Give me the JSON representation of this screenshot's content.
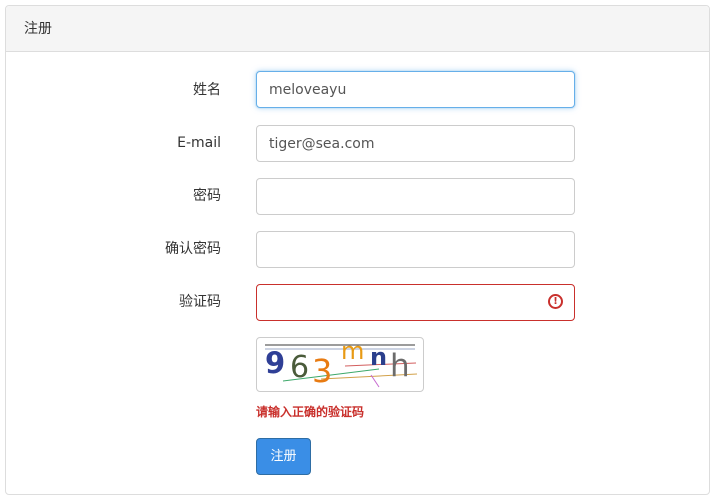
{
  "panel": {
    "title": "注册"
  },
  "form": {
    "fields": [
      {
        "label": "姓名",
        "value": "meloveayu",
        "placeholder": "",
        "state": "focused"
      },
      {
        "label": "E-mail",
        "value": "tiger@sea.com",
        "placeholder": "",
        "state": "normal"
      },
      {
        "label": "密码",
        "value": "",
        "placeholder": "",
        "state": "normal"
      },
      {
        "label": "确认密码",
        "value": "",
        "placeholder": "",
        "state": "normal"
      },
      {
        "label": "验证码",
        "value": "",
        "placeholder": "",
        "state": "error"
      }
    ],
    "captcha": {
      "text": "963mnh",
      "chars": [
        {
          "char": "9",
          "color": "#2f3f96"
        },
        {
          "char": "6",
          "color": "#4a5b3a"
        },
        {
          "char": "3",
          "color": "#e87b12"
        },
        {
          "char": "m",
          "color": "#e89a14"
        },
        {
          "char": "n",
          "color": "#2b3f8c"
        },
        {
          "char": "h",
          "color": "#6b6b6b"
        }
      ]
    },
    "error_message": "请输入正确的验证码",
    "submit_label": "注册"
  },
  "icons": {
    "error_icon": "exclamation-circle-icon"
  },
  "colors": {
    "error": "#c9302c",
    "focus_border": "#66afe9",
    "primary_button": "#3a8ee6"
  }
}
